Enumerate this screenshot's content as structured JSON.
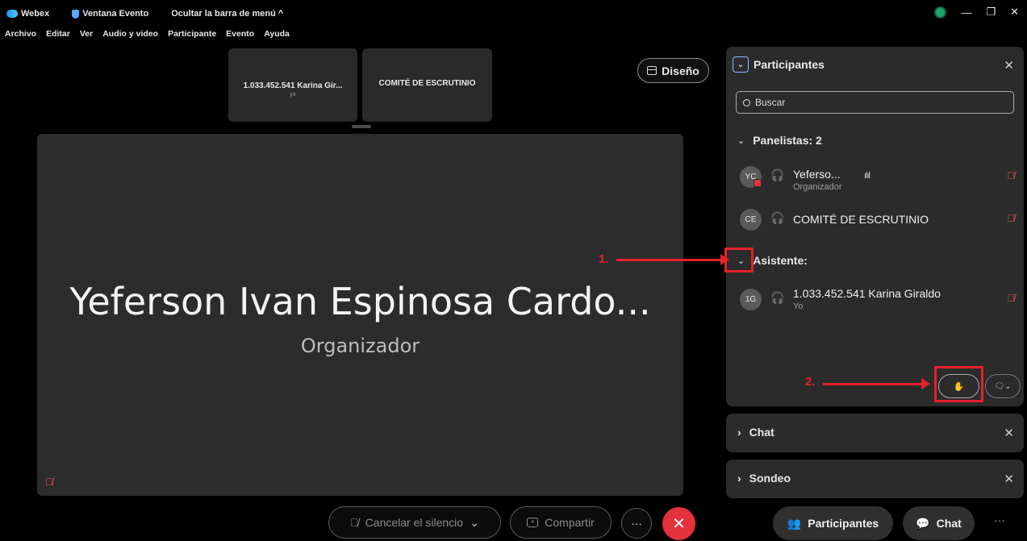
{
  "titlebar": {
    "app_name": "Webex",
    "event_window": "Ventana Evento",
    "hide_menu": "Ocultar la barra de menú ^"
  },
  "menu": [
    "Archivo",
    "Editar",
    "Ver",
    "Audio y video",
    "Participante",
    "Evento",
    "Ayuda"
  ],
  "thumbnails": [
    {
      "name": "1.033.452.541 Karina Gir...",
      "sub": "yo"
    },
    {
      "name": "COMITÉ DE ESCRUTINIO"
    }
  ],
  "layout_button": "Diseño",
  "stage": {
    "name": "Yeferson Ivan Espinosa Cardo...",
    "role": "Organizador"
  },
  "controls": {
    "unmute": "Cancelar el silencio",
    "share": "Compartir",
    "more": "···",
    "leave": "✕",
    "participants": "Participantes",
    "chat": "Chat",
    "overflow": "···"
  },
  "panel": {
    "title": "Participantes",
    "search_placeholder": "Buscar",
    "panelists_header": "Panelistas: 2",
    "attendees_header": "Asistente:",
    "panelists": [
      {
        "initials": "YC",
        "name": "Yeferso...",
        "role": "Organizador"
      },
      {
        "initials": "CE",
        "name": "COMITÉ DE ESCRUTINIO"
      }
    ],
    "attendees": [
      {
        "initials": "1G",
        "name": "1.033.452.541 Karina Giraldo",
        "role": "Yo"
      }
    ]
  },
  "collapsed_panels": [
    {
      "label": "Chat"
    },
    {
      "label": "Sondeo"
    }
  ],
  "annotations": {
    "step1": "1.",
    "step2": "2."
  },
  "colors": {
    "background": "#000000",
    "panel": "#2b2b2b",
    "muted_red": "#e4555e",
    "leave_red": "#e5303d",
    "annotation_red": "#e8202a",
    "status_green": "#1ea36b"
  }
}
